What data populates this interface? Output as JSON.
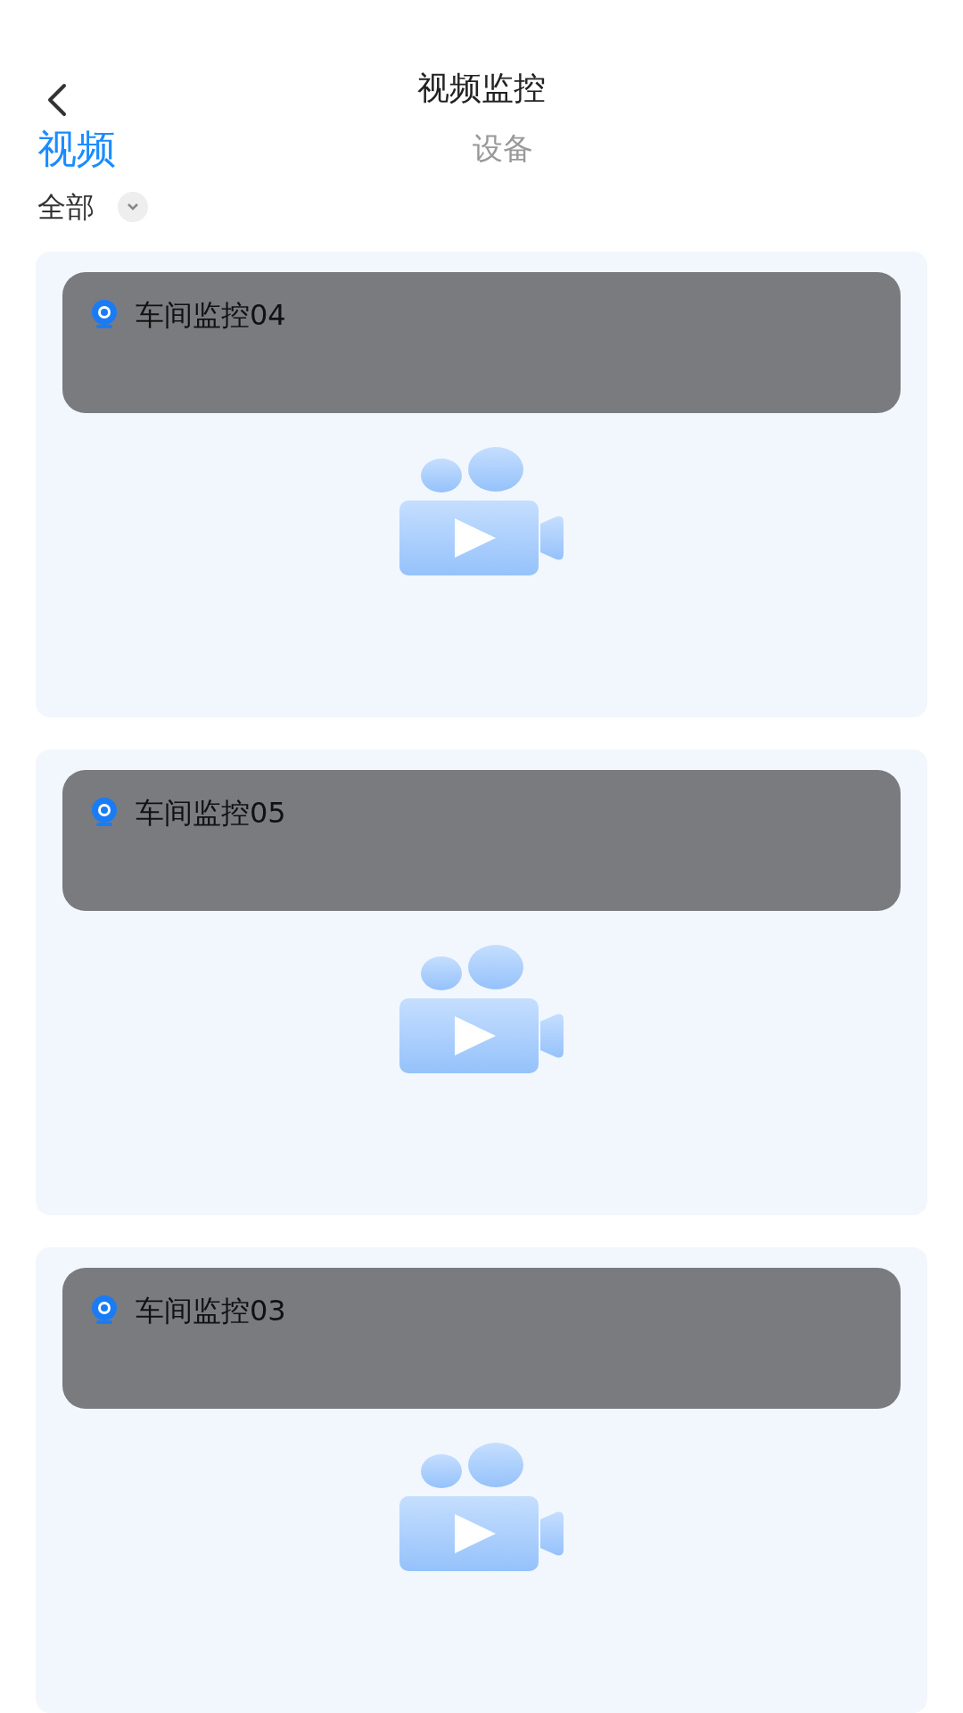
{
  "header": {
    "title": "视频监控"
  },
  "tabs": [
    {
      "label": "视频",
      "selected": true
    },
    {
      "label": "设备",
      "selected": false
    }
  ],
  "filter": {
    "label": "全部"
  },
  "cards": [
    {
      "name": "车间监控04"
    },
    {
      "name": "车间监控05"
    },
    {
      "name": "车间监控03"
    }
  ]
}
